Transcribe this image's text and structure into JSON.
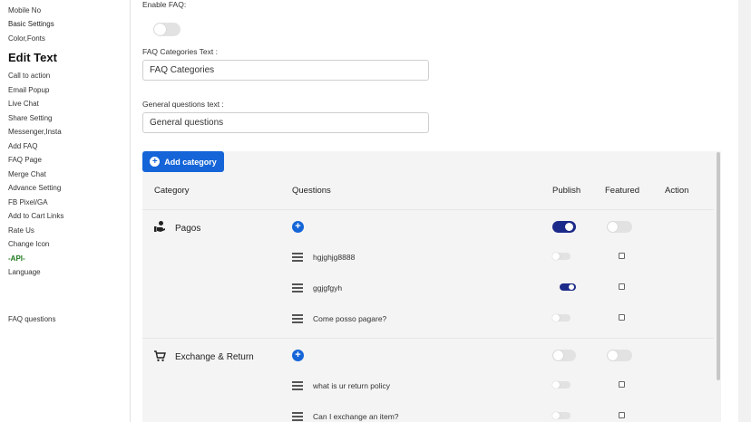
{
  "sidebar": {
    "items_top": [
      "Mobile No",
      "Basic Settings",
      "Color,Fonts"
    ],
    "heading": "Edit Text",
    "items": [
      "Call to action",
      "Email Popup",
      "Live Chat",
      "Share Setting",
      "Messenger,Insta",
      "Add FAQ",
      "FAQ Page",
      "Merge Chat",
      "Advance Setting",
      "FB Pixel/GA",
      "Add to Cart Links",
      "Rate Us",
      "Change Icon",
      "-API-",
      "Language"
    ],
    "bottom_item": "FAQ questions"
  },
  "settings": {
    "enable_faq_label": "Enable FAQ:",
    "enable_faq_on": false,
    "faq_categories_label": "FAQ Categories Text :",
    "faq_categories_value": "FAQ Categories",
    "general_questions_label": "General questions text :",
    "general_questions_value": "General questions"
  },
  "table": {
    "add_button": "Add category",
    "headers": {
      "category": "Category",
      "questions": "Questions",
      "publish": "Publish",
      "featured": "Featured",
      "action": "Action"
    },
    "categories": [
      {
        "name": "Pagos",
        "icon": "hand-money-icon",
        "publish": true,
        "featured": false,
        "questions": [
          {
            "text": "hgjghjg8888",
            "publish": false,
            "featured": false
          },
          {
            "text": "ggjgfgyh",
            "publish": true,
            "featured": false
          },
          {
            "text": "Come posso pagare?",
            "publish": false,
            "featured": false
          }
        ]
      },
      {
        "name": "Exchange & Return",
        "icon": "cart-icon",
        "publish": false,
        "featured": false,
        "questions": [
          {
            "text": "what is ur return policy",
            "publish": false,
            "featured": false
          },
          {
            "text": "Can I exchange an item?",
            "publish": false,
            "featured": false
          }
        ]
      }
    ]
  },
  "colors": {
    "accent": "#1565d8",
    "toggle_on": "#1c2a8a",
    "api_text": "#1f7a1f"
  }
}
